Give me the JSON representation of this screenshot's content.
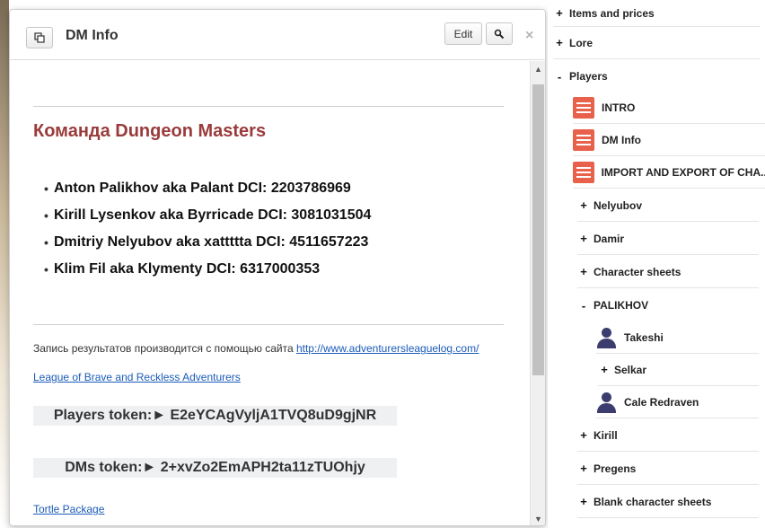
{
  "modal": {
    "title": "DM Info",
    "edit_label": "Edit",
    "close_label": "×",
    "heading": "Команда Dungeon Masters",
    "members": [
      "Anton Palikhov aka Palant DCI: 2203786969",
      "Kirill Lysenkov aka Byrricade DCI: 3081031504",
      "Dmitriy Nelyubov aka xattttta DCI: 4511657223",
      "Klim Fil aka Klymenty DCI: 6317000353"
    ],
    "results_text": "Запись результатов производится с помощью сайта ",
    "results_link": "http://www.adventurersleaguelog.com/",
    "league_link": "League of Brave and Reckless Adventurers",
    "players_token": "Players token:► E2eYCAgVyljA1TVQ8uD9gjNR",
    "dms_token": "DMs token:► 2+xvZo2EmAPH2ta11zTUOhjy",
    "tortle_link": "Tortle Package"
  },
  "tree": {
    "items_prices": "Items and prices",
    "lore": "Lore",
    "players": "Players",
    "intro": "INTRO",
    "dm_info": "DM Info",
    "import_export": "IMPORT AND EXPORT OF CHA...",
    "nelyubov": "Nelyubov",
    "damir": "Damir",
    "character_sheets": "Character sheets",
    "palikhov": "PALIKHOV",
    "takeshi": "Takeshi",
    "selkar": "Selkar",
    "cale": "Cale Redraven",
    "kirill": "Kirill",
    "pregens": "Pregens",
    "blank_sheets": "Blank character sheets",
    "plus": "+",
    "minus": "-"
  },
  "colors": {
    "heading": "#9a3b3b",
    "link": "#1a5bb8",
    "doc_icon": "#e8614a",
    "person_icon": "#3c3d6e"
  }
}
